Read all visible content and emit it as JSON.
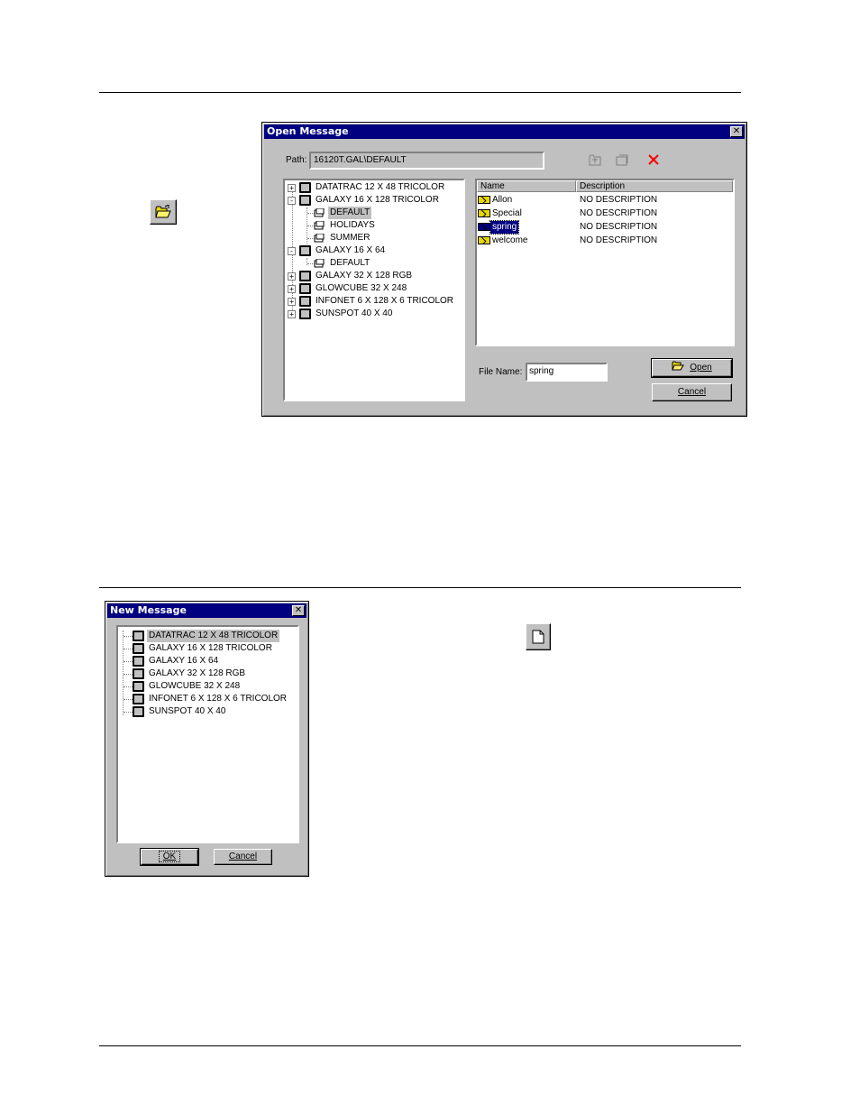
{
  "open_dialog": {
    "title": "Open Message",
    "path_label": "Path:",
    "path_value": "16120T.GAL\\DEFAULT",
    "tree": [
      {
        "label": "DATATRAC 12 X 48 TRICOLOR",
        "expander": "+"
      },
      {
        "label": "GALAXY 16 X 128 TRICOLOR",
        "expander": "-"
      },
      {
        "label": "DEFAULT"
      },
      {
        "label": "HOLIDAYS"
      },
      {
        "label": "SUMMER"
      },
      {
        "label": "GALAXY 16 X 64",
        "expander": "-"
      },
      {
        "label": "DEFAULT"
      },
      {
        "label": "GALAXY 32 X 128 RGB",
        "expander": "+"
      },
      {
        "label": "GLOWCUBE 32 X 248",
        "expander": "+"
      },
      {
        "label": "INFONET 6 X 128 X 6 TRICOLOR",
        "expander": "+"
      },
      {
        "label": "SUNSPOT 40 X 40",
        "expander": "+"
      }
    ],
    "list_headers": {
      "name": "Name",
      "description": "Description"
    },
    "list_rows": [
      {
        "name": "Allon",
        "description": "NO DESCRIPTION"
      },
      {
        "name": "Special",
        "description": "NO DESCRIPTION"
      },
      {
        "name": "spring",
        "description": "NO DESCRIPTION"
      },
      {
        "name": "welcome",
        "description": "NO DESCRIPTION"
      }
    ],
    "file_name_label": "File Name:",
    "file_name_value": "spring",
    "open_button": "Open",
    "cancel_button": "Cancel"
  },
  "new_dialog": {
    "title": "New Message",
    "tree": [
      {
        "label": "DATATRAC 12 X 48 TRICOLOR"
      },
      {
        "label": "GALAXY 16 X 128 TRICOLOR"
      },
      {
        "label": "GALAXY 16 X 64"
      },
      {
        "label": "GALAXY 32 X 128 RGB"
      },
      {
        "label": "GLOWCUBE 32 X 248"
      },
      {
        "label": "INFONET 6 X 128 X 6 TRICOLOR"
      },
      {
        "label": "SUNSPOT 40 X 40"
      }
    ],
    "ok_button": "OK",
    "cancel_button": "Cancel"
  },
  "icons": {
    "open_folder": "open-folder-icon",
    "new_document": "new-document-icon",
    "delete": "delete-x-icon"
  },
  "colors": {
    "titlebar": "#000080",
    "dialog_face": "#c0c0c0",
    "selection": "#000080",
    "delete_icon": "#ff0000",
    "envelope": "#e8d800"
  }
}
